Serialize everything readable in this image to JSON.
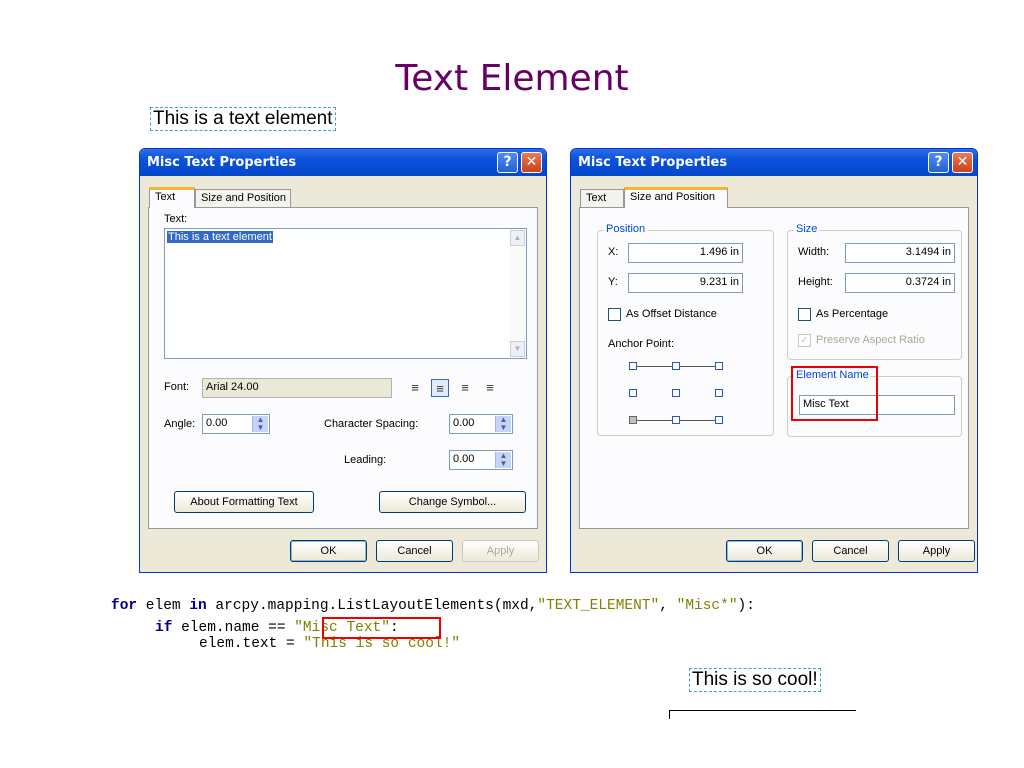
{
  "slide": {
    "title": "Text Element"
  },
  "sample_text_before": "This is a text element",
  "sample_text_after": "This is so cool!",
  "dialog_left": {
    "title": "Misc Text Properties",
    "help_glyph": "?",
    "close_glyph": "✕",
    "tabs": [
      "Text",
      "Size and Position"
    ],
    "active_tab": "Text",
    "text_label": "Text:",
    "text_value": "This is a text element",
    "font_label": "Font:",
    "font_value": "Arial 24.00",
    "angle_label": "Angle:",
    "angle_value": "0.00",
    "char_spacing_label": "Character Spacing:",
    "char_spacing_value": "0.00",
    "leading_label": "Leading:",
    "leading_value": "0.00",
    "about_button": "About Formatting Text",
    "change_symbol_button": "Change Symbol...",
    "ok": "OK",
    "cancel": "Cancel",
    "apply": "Apply"
  },
  "dialog_right": {
    "title": "Misc Text Properties",
    "help_glyph": "?",
    "close_glyph": "✕",
    "tabs": [
      "Text",
      "Size and Position"
    ],
    "active_tab": "Size and Position",
    "position_group": "Position",
    "x_label": "X:",
    "x_value": "1.496 in",
    "y_label": "Y:",
    "y_value": "9.231 in",
    "offset_label": "As Offset Distance",
    "anchor_label": "Anchor Point:",
    "size_group": "Size",
    "width_label": "Width:",
    "width_value": "3.1494 in",
    "height_label": "Height:",
    "height_value": "0.3724 in",
    "percentage_label": "As Percentage",
    "aspect_label": "Preserve Aspect Ratio",
    "element_name_group": "Element Name",
    "element_name_value": "Misc Text",
    "ok": "OK",
    "cancel": "Cancel",
    "apply": "Apply"
  },
  "code": {
    "l1_kw1": "for",
    "l1_a": " elem ",
    "l1_kw2": "in",
    "l1_b": " arcpy.mapping.ListLayoutElements(mxd,",
    "l1_s1": "\"TEXT_ELEMENT\"",
    "l1_c": ", ",
    "l1_s2": "\"Misc*\"",
    "l1_d": "):",
    "l2_kw": "if",
    "l2_a": " elem.name == ",
    "l2_s": "\"Misc Text\"",
    "l2_b": ":",
    "l3_a": "elem.text = ",
    "l3_s": "\"This is so cool!\""
  }
}
